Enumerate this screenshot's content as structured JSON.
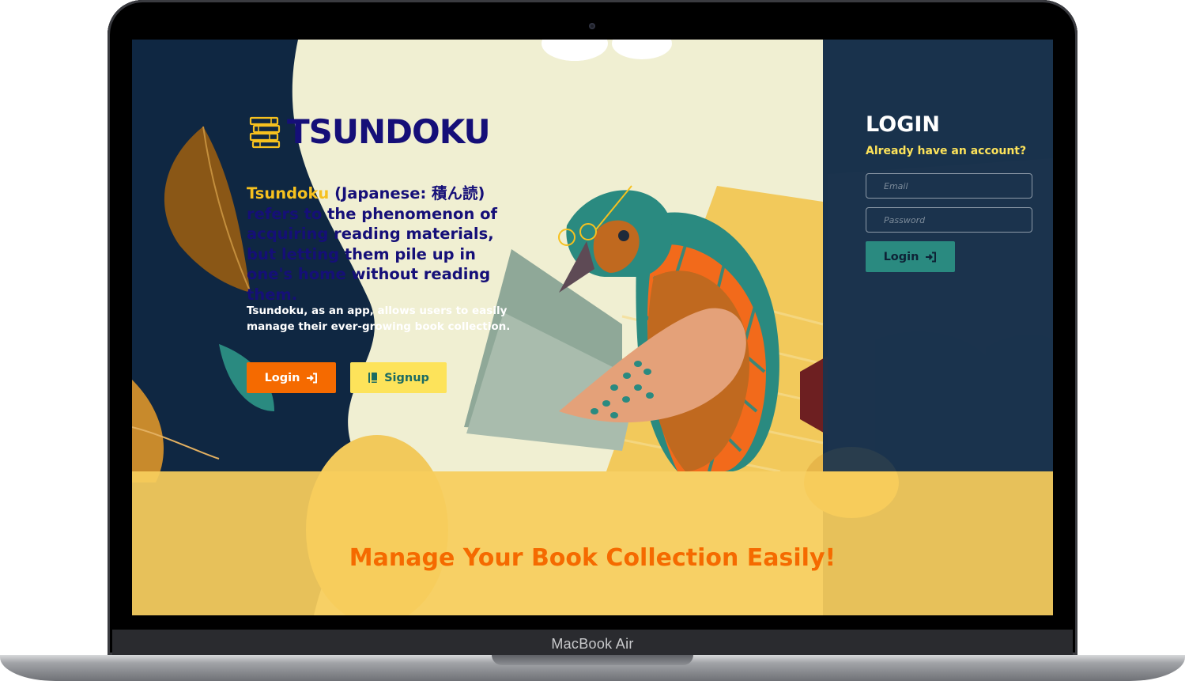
{
  "device": {
    "model_label": "MacBook Air"
  },
  "brand": {
    "title": "TSUNDOKU",
    "logo_icon": "books-stack-icon"
  },
  "hero": {
    "headline_highlight": "Tsundoku",
    "headline_rest": " (Japanese: 積ん読) refers to the phenomenon of acquiring reading materials, but letting them pile up in one's home without reading them.",
    "description": "Tsundoku, as an app, allows users to easily manage their ever-growing book collection.",
    "login_label": "Login",
    "login_icon": "sign-in-icon",
    "signup_label": "Signup",
    "signup_icon": "book-icon"
  },
  "login_panel": {
    "title": "LOGIN",
    "subtitle": "Already have an account?",
    "email_placeholder": "Email",
    "password_placeholder": "Password",
    "submit_label": "Login",
    "submit_icon": "sign-in-icon"
  },
  "footer_band": {
    "tagline": "Manage Your Book Collection Easily!"
  },
  "colors": {
    "navy": "#0f2742",
    "cream": "#f0efd2",
    "brand_purple": "#150f78",
    "accent_yellow": "#f6c11f",
    "orange": "#f56a00",
    "teal": "#2a8a80",
    "band_yellow": "#f8cd5c"
  }
}
